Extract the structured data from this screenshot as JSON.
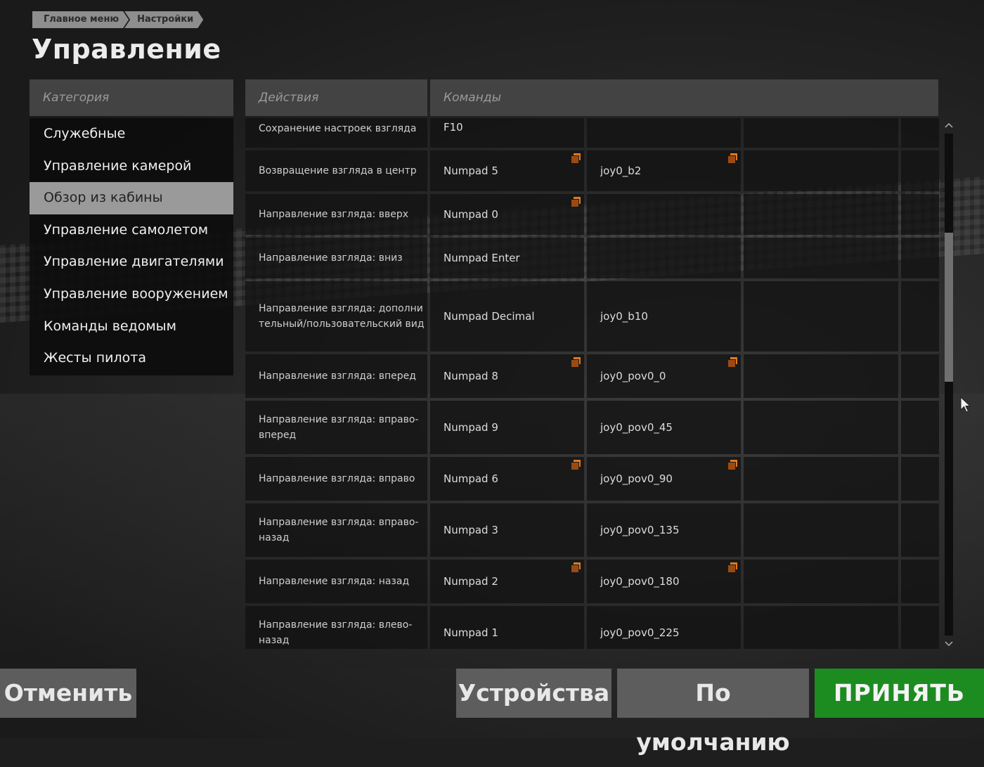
{
  "breadcrumb": [
    "Главное меню",
    "Настройки"
  ],
  "page_title": "Управление",
  "category_header": "Категория",
  "actions_header": "Действия",
  "commands_header": "Команды",
  "categories": [
    {
      "label": "Служебные",
      "selected": false
    },
    {
      "label": "Управление камерой",
      "selected": false
    },
    {
      "label": "Обзор из кабины",
      "selected": true
    },
    {
      "label": "Управление самолетом",
      "selected": false
    },
    {
      "label": "Управление двигателями",
      "selected": false
    },
    {
      "label": "Управление вооружением",
      "selected": false
    },
    {
      "label": "Команды ведомым",
      "selected": false
    },
    {
      "label": "Жесты пилота",
      "selected": false
    }
  ],
  "bindings": [
    {
      "action": "Сохранение настроек взгляда",
      "cmd1": "F10",
      "cmd2": "",
      "flag1": false,
      "flag2": false
    },
    {
      "action": "Возвращение взгляда в центр",
      "cmd1": "Numpad 5",
      "cmd2": "joy0_b2",
      "flag1": true,
      "flag2": true
    },
    {
      "action": "Направление взгляда: вверх",
      "cmd1": "Numpad 0",
      "cmd2": "",
      "flag1": true,
      "flag2": false
    },
    {
      "action": "Направление взгляда: вниз",
      "cmd1": "Numpad Enter",
      "cmd2": "",
      "flag1": false,
      "flag2": false
    },
    {
      "action": "Направление взгляда: дополнительный/пользовательский вид",
      "cmd1": "Numpad Decimal",
      "cmd2": "joy0_b10",
      "flag1": false,
      "flag2": false
    },
    {
      "action": "Направление взгляда: вперед",
      "cmd1": "Numpad 8",
      "cmd2": "joy0_pov0_0",
      "flag1": true,
      "flag2": true
    },
    {
      "action": "Направление взгляда: вправо-вперед",
      "cmd1": "Numpad 9",
      "cmd2": "joy0_pov0_45",
      "flag1": false,
      "flag2": false
    },
    {
      "action": "Направление взгляда: вправо",
      "cmd1": "Numpad 6",
      "cmd2": "joy0_pov0_90",
      "flag1": true,
      "flag2": true
    },
    {
      "action": "Направление взгляда: вправо-назад",
      "cmd1": "Numpad 3",
      "cmd2": "joy0_pov0_135",
      "flag1": false,
      "flag2": false
    },
    {
      "action": "Направление взгляда: назад",
      "cmd1": "Numpad 2",
      "cmd2": "joy0_pov0_180",
      "flag1": true,
      "flag2": true
    },
    {
      "action": "Направление взгляда: влево-назад",
      "cmd1": "Numpad 1",
      "cmd2": "joy0_pov0_225",
      "flag1": false,
      "flag2": false
    }
  ],
  "buttons": {
    "cancel": "Отменить",
    "devices": "Устройства",
    "defaults": "По умолчанию",
    "accept": "ПРИНЯТЬ"
  },
  "colors": {
    "accent_green": "#1c8c21",
    "flag_orange": "#e07a1f",
    "selected_category": "#9a9a9a"
  },
  "scroll_position": 0.28,
  "icons": {
    "scroll_up": "chevron-up-icon",
    "scroll_down": "chevron-down-icon",
    "binding_flag": "modified-binding-icon",
    "cursor": "mouse-pointer-icon"
  }
}
